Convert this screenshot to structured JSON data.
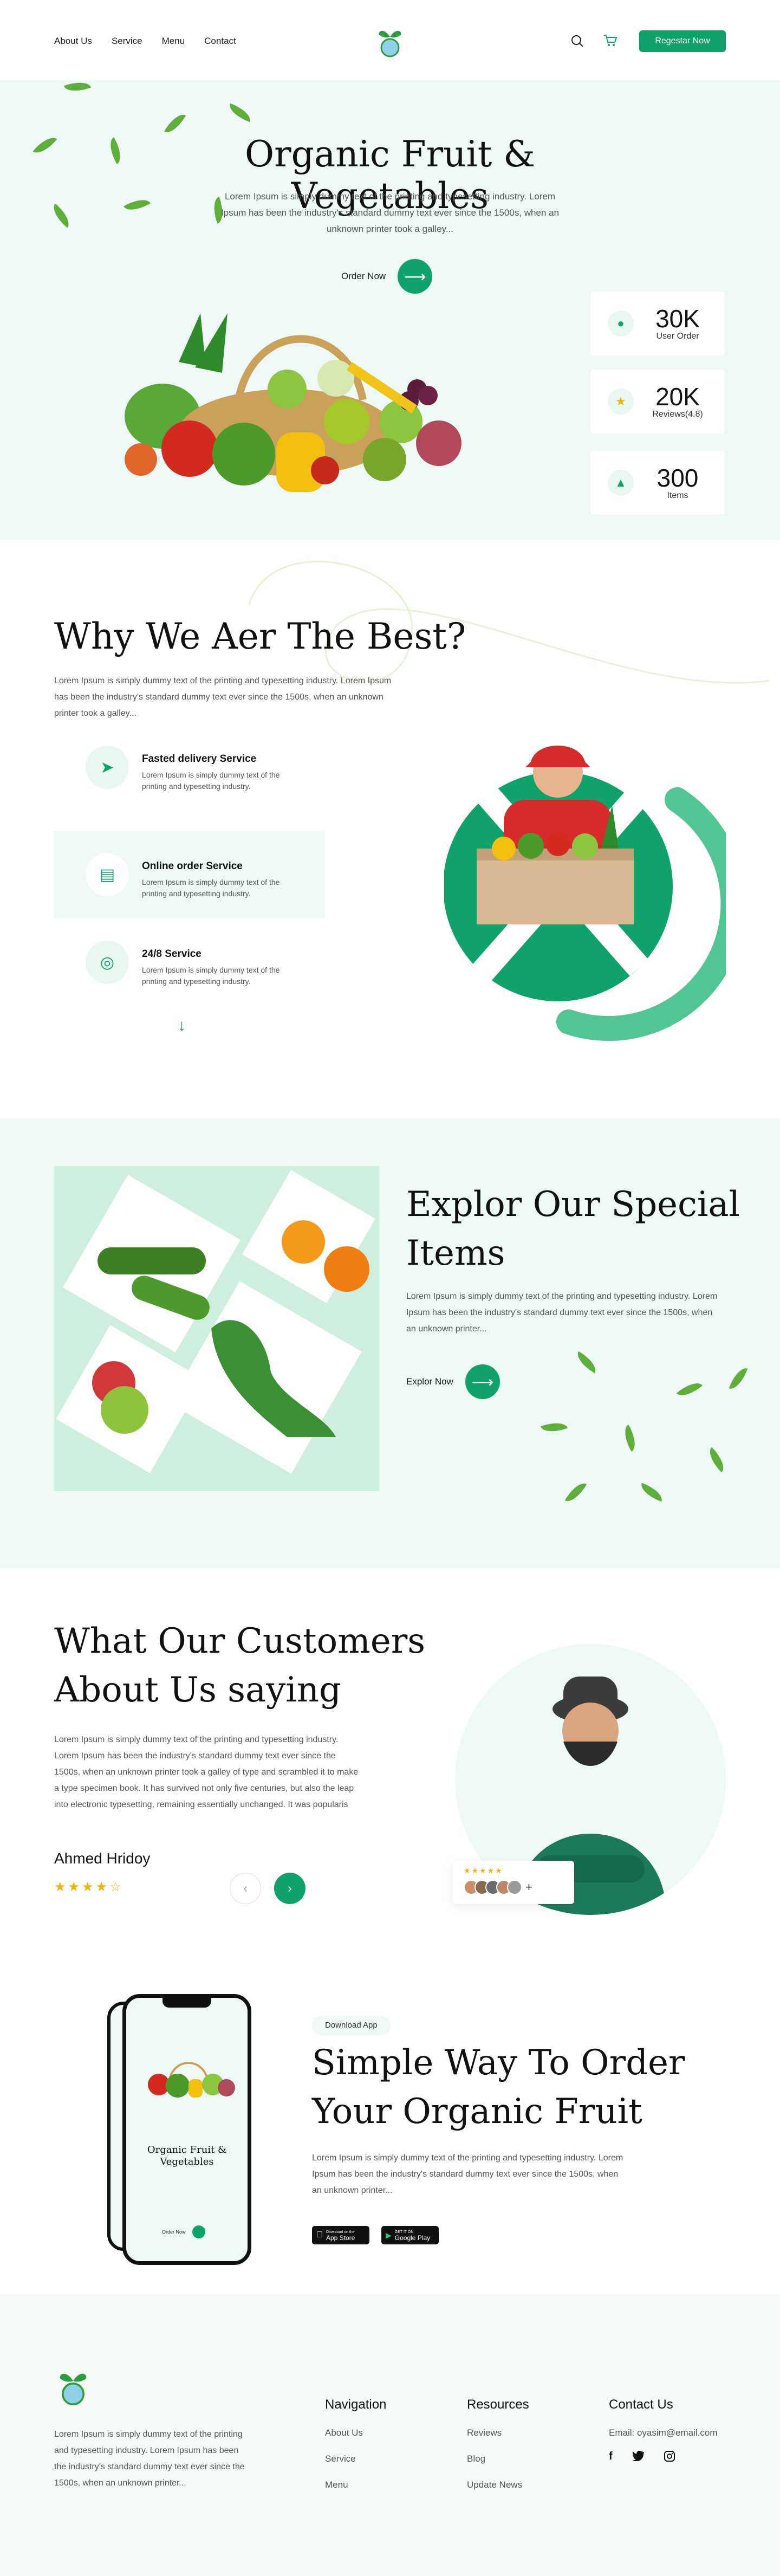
{
  "nav": {
    "links": [
      "About Us",
      "Service",
      "Menu",
      "Contact"
    ],
    "register_label": "Regestar Now"
  },
  "hero": {
    "title": "Organic Fruit & Vegetables",
    "description": "Lorem Ipsum is simply dummy text of the printing and typesetting industry. Lorem Ipsum has been the industry's standard dummy text ever since the 1500s, when an unknown printer took a galley...",
    "cta_label": "Order Now",
    "stats": [
      {
        "value": "30K",
        "label": "User Order",
        "icon": "user-icon"
      },
      {
        "value": "20K",
        "label": "Reviews(4.8)",
        "icon": "star-icon"
      },
      {
        "value": "300",
        "label": "Items",
        "icon": "basket-icon"
      }
    ]
  },
  "why": {
    "title": "Why We Aer The Best?",
    "description": "Lorem Ipsum is simply dummy text of the printing and typesetting industry. Lorem Ipsum has been the industry's standard dummy text ever since the 1500s, when an unknown printer took a galley...",
    "services": [
      {
        "title": "Fasted delivery Service",
        "desc": "Lorem Ipsum is simply dummy text of the printing and typesetting industry.",
        "icon": "delivery-icon"
      },
      {
        "title": "Online order Service",
        "desc": "Lorem Ipsum is simply dummy text of the printing and typesetting industry.",
        "icon": "order-icon"
      },
      {
        "title": "24/8 Service",
        "desc": "Lorem Ipsum is simply dummy text of the printing and typesetting industry.",
        "icon": "service-icon"
      }
    ]
  },
  "special": {
    "title_line1": "Explor Our Special",
    "title_line2": "Items",
    "description": "Lorem Ipsum is simply dummy text of the printing and typesetting industry. Lorem Ipsum has been the industry's standard dummy text ever since the 1500s, when an unknown printer...",
    "cta_label": "Explor Now"
  },
  "testimonial": {
    "title_line1": "What Our Customers",
    "title_line2": "About Us saying",
    "quote": "Lorem Ipsum is simply dummy text of the printing and typesetting industry. Lorem Ipsum has been the industry's standard dummy text ever since the 1500s, when an unknown printer took a galley of type and scrambled it to make a type specimen book. It has survived not only five centuries, but also the leap into electronic typesetting, remaining essentially unchanged. It was popularis",
    "author": "Ahmed Hridoy",
    "rating": 4.5,
    "more_label": "+"
  },
  "app": {
    "badge": "Download App",
    "title_line1": "Simple Way To Order",
    "title_line2": "Your Organic Fruit",
    "description": "Lorem Ipsum is simply dummy text of the printing and typesetting industry. Lorem Ipsum has been the industry's standard dummy text ever since the 1500s, when an unknown printer...",
    "appstore_top": "Download on the",
    "appstore_label": "App Store",
    "googleplay_top": "GET IT ON",
    "googleplay_label": "Google Play",
    "phone_title_line1": "Organic Fruit &",
    "phone_title_line2": "Vegetables",
    "phone_cta": "Order Now"
  },
  "footer": {
    "about": "Lorem Ipsum is simply dummy text of the printing and typesetting industry. Lorem Ipsum has been the industry's standard dummy text ever since the 1500s, when an unknown printer...",
    "navigation_title": "Navigation",
    "navigation": [
      "About Us",
      "Service",
      "Menu"
    ],
    "resources_title": "Resources",
    "resources": [
      "Reviews",
      "Blog",
      "Update News"
    ],
    "contact_title": "Contact Us",
    "email": "Email: oyasim@email.com"
  },
  "colors": {
    "accent": "#0fa26a",
    "mint": "#eef8f4",
    "star": "#f5b301"
  }
}
